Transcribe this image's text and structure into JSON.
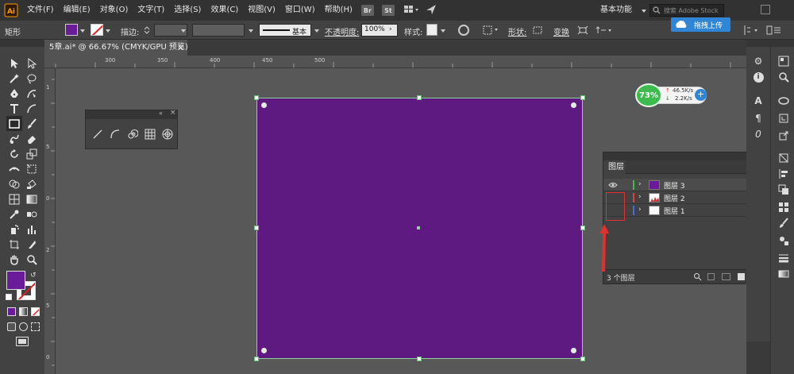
{
  "menubar": {
    "logo": "Ai",
    "items": [
      "文件(F)",
      "编辑(E)",
      "对象(O)",
      "文字(T)",
      "选择(S)",
      "效果(C)",
      "视图(V)",
      "窗口(W)",
      "帮助(H)"
    ],
    "badge_br": "Br",
    "badge_st": "St",
    "workspace": "基本功能",
    "search_placeholder": "搜索 Adobe Stock",
    "upload_label": "拖拽上传"
  },
  "options": {
    "object_type": "矩形",
    "stroke_label": "描边:",
    "brush_label": "基本",
    "opacity_label": "不透明度:",
    "opacity_value": "100%",
    "style_label": "样式:",
    "shape_label": "形状:",
    "transform_label": "变换"
  },
  "document": {
    "tab_title": "5章.ai* @ 66.67% (CMYK/GPU 预览)",
    "close": "×"
  },
  "ruler": {
    "top_labels": [
      "300",
      "350",
      "400",
      "450",
      "500"
    ],
    "left_labels": [
      "1",
      "5",
      "0",
      "2",
      "5",
      "0"
    ]
  },
  "speed_widget": {
    "percent": "73%",
    "up": "46.5K/s",
    "down": "2.2K/s"
  },
  "layers_panel": {
    "tab": "图层",
    "layers": [
      {
        "name": "图层 3",
        "color": "#40c040",
        "selected": true
      },
      {
        "name": "图层 2",
        "color": "#e04040",
        "selected": false
      },
      {
        "name": "图层 1",
        "color": "#4070e0",
        "selected": false
      }
    ],
    "count": "3 个图层"
  },
  "colors": {
    "artboard_fill": "#5e1a80",
    "fill_swatch": "#6a1b9a",
    "annotation": "#e03030"
  }
}
